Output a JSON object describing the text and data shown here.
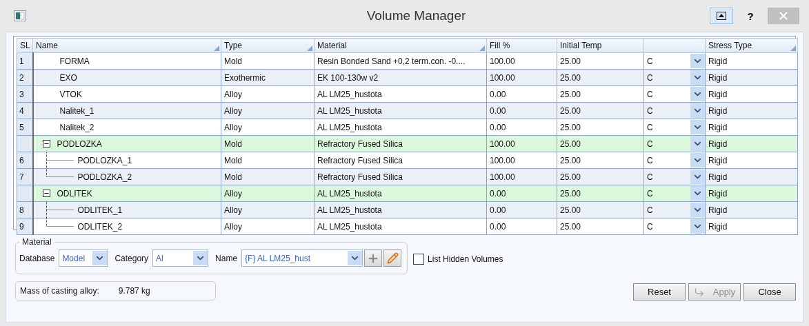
{
  "window": {
    "title": "Volume Manager",
    "help_label": "?"
  },
  "table": {
    "columns": [
      {
        "label": "SL",
        "sorted": false
      },
      {
        "label": "Name",
        "sorted": true
      },
      {
        "label": "Type",
        "sorted": true
      },
      {
        "label": "Material",
        "sorted": true
      },
      {
        "label": "Fill %",
        "sorted": false
      },
      {
        "label": "Initial Temp",
        "sorted": false
      },
      {
        "sorted": false
      },
      {
        "label": "Stress Type",
        "sorted": true
      }
    ],
    "rows": [
      {
        "kind": "item",
        "sl": "1",
        "name": "FORMA",
        "type": "Mold",
        "material": "Resin Bonded Sand +0,2 term.con. -0....",
        "fill": "100.00",
        "temp": "25.00",
        "unit": "C",
        "stress": "Rigid"
      },
      {
        "kind": "item",
        "sl": "2",
        "name": "EXO",
        "type": "Exothermic",
        "material": "EK 100-130w v2",
        "fill": "100.00",
        "temp": "25.00",
        "unit": "C",
        "stress": "Rigid"
      },
      {
        "kind": "item",
        "sl": "3",
        "name": "VTOK",
        "type": "Alloy",
        "material": "AL LM25_hustota",
        "fill": "0.00",
        "temp": "25.00",
        "unit": "C",
        "stress": "Rigid"
      },
      {
        "kind": "item",
        "sl": "4",
        "name": "Nalitek_1",
        "type": "Alloy",
        "material": "AL LM25_hustota",
        "fill": "0.00",
        "temp": "25.00",
        "unit": "C",
        "stress": "Rigid"
      },
      {
        "kind": "item",
        "sl": "5",
        "name": "Nalitek_2",
        "type": "Alloy",
        "material": "AL LM25_hustota",
        "fill": "0.00",
        "temp": "25.00",
        "unit": "C",
        "stress": "Rigid"
      },
      {
        "kind": "group",
        "expanded": true,
        "name": "PODLOZKA",
        "type": "Mold",
        "material": "Refractory Fused Silica",
        "fill": "100.00",
        "temp": "25.00",
        "unit": "C",
        "stress": "Rigid",
        "children": [
          {
            "kind": "item",
            "sl": "6",
            "name": "PODLOZKA_1",
            "type": "Mold",
            "material": "Refractory Fused Silica",
            "fill": "100.00",
            "temp": "25.00",
            "unit": "C",
            "stress": "Rigid"
          },
          {
            "kind": "item",
            "sl": "7",
            "name": "PODLOZKA_2",
            "type": "Mold",
            "material": "Refractory Fused Silica",
            "fill": "100.00",
            "temp": "25.00",
            "unit": "C",
            "stress": "Rigid"
          }
        ]
      },
      {
        "kind": "group",
        "expanded": true,
        "name": "ODLITEK",
        "type": "Alloy",
        "material": "AL LM25_hustota",
        "fill": "0.00",
        "temp": "25.00",
        "unit": "C",
        "stress": "Rigid",
        "children": [
          {
            "kind": "item",
            "sl": "8",
            "name": "ODLITEK_1",
            "type": "Alloy",
            "material": "AL LM25_hustota",
            "fill": "0.00",
            "temp": "25.00",
            "unit": "C",
            "stress": "Rigid"
          },
          {
            "kind": "item",
            "sl": "9",
            "name": "ODLITEK_2",
            "type": "Alloy",
            "material": "AL LM25_hustota",
            "fill": "0.00",
            "temp": "25.00",
            "unit": "C",
            "stress": "Rigid"
          }
        ]
      }
    ]
  },
  "material": {
    "title": "Material",
    "fields": [
      {
        "label": "Database",
        "value": "Model"
      },
      {
        "label": "Category",
        "value": "Al"
      },
      {
        "label": "Name",
        "value": "{F} AL LM25_hust"
      }
    ]
  },
  "list_hidden": {
    "label": "List Hidden Volumes",
    "checked": false
  },
  "mass": {
    "label": "Mass of casting alloy:",
    "value": "9.787 kg"
  },
  "buttons": [
    {
      "kind": "reset",
      "label": "Reset",
      "disabled": false
    },
    {
      "kind": "apply",
      "label": "Apply",
      "disabled": true
    },
    {
      "kind": "close",
      "label": "Close",
      "disabled": false
    }
  ]
}
